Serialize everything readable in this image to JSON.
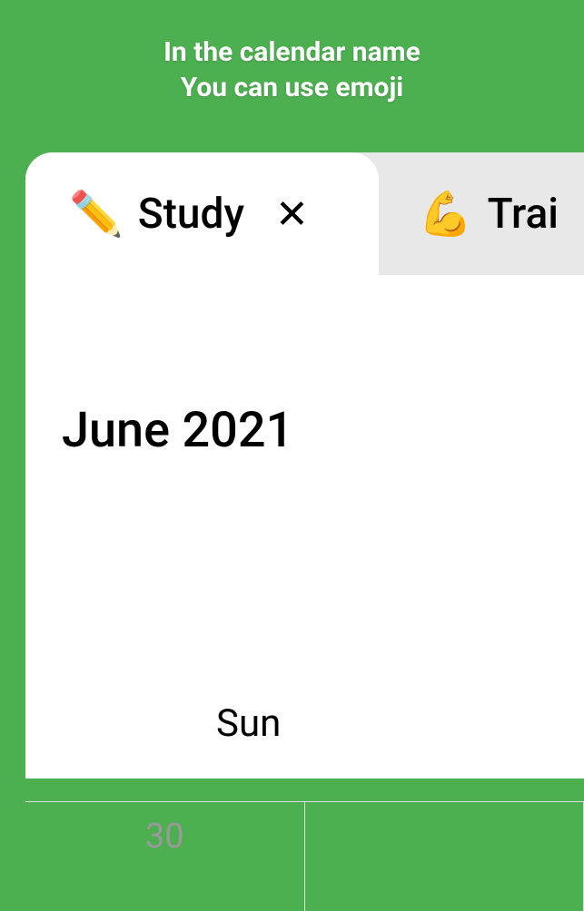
{
  "promo": {
    "line1": "In the calendar name",
    "line2": "You can use emoji"
  },
  "tabs": {
    "active": {
      "emoji": "✏️",
      "label": "Study"
    },
    "inactive": {
      "emoji": "💪",
      "label": "Trai"
    }
  },
  "calendar": {
    "month_title": "June 2021",
    "day_header": "Sun",
    "prev_day": "30"
  }
}
